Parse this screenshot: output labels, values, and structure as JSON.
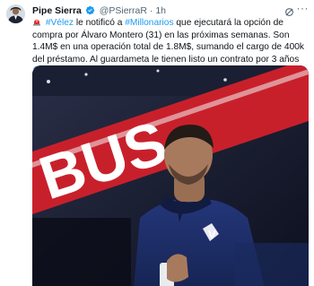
{
  "tweet": {
    "author_name": "Pipe Sierra",
    "handle": "@PSierraR",
    "separator": "·",
    "time": "1h",
    "text": {
      "hashtag_1": "#Vélez",
      "part_1": " le notificó a ",
      "hashtag_2": "#Millonarios",
      "part_2": " que ejecutará la opción de compra por Álvaro Montero (31) en las próximas semanas. Son 1.4M$ en una operación total de 1.8M$, sumando el cargo de 400k del préstamo. Al guardameta le tienen listo un contrato por 3 años"
    },
    "media": {
      "sign_text": "BUS",
      "jacket_logo": "V"
    }
  },
  "icons": {
    "alert": "red-siren-emoji",
    "verified": "verified-badge-icon",
    "grok": "grok-icon",
    "more": "more-options-icon",
    "flags": [
      "argentina-flag-icon",
      "colombia-flag-icon"
    ]
  },
  "colors": {
    "link": "#1d9bf0",
    "text": "#0f1419",
    "secondary": "#536471",
    "jacket": "#1d2f6a",
    "sign_red": "#c8202b"
  }
}
